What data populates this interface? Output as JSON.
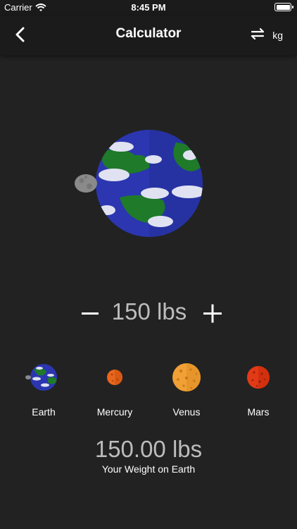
{
  "status_bar": {
    "carrier": "Carrier",
    "time": "8:45 PM"
  },
  "nav": {
    "title": "Calculator",
    "unit_label": "kg",
    "back_icon": "chevron-left-icon",
    "swap_icon": "swap-arrows-icon"
  },
  "weight": {
    "value": "150 lbs",
    "minus_icon": "minus-icon",
    "plus_icon": "plus-icon"
  },
  "planets": [
    {
      "name": "Earth",
      "color": "#2b36b0"
    },
    {
      "name": "Mercury",
      "color": "#e8661c"
    },
    {
      "name": "Venus",
      "color": "#f0a035"
    },
    {
      "name": "Mars",
      "color": "#e23a16"
    }
  ],
  "result": {
    "value": "150.00 lbs",
    "caption": "Your Weight on Earth"
  },
  "colors": {
    "background": "#222222",
    "bar": "#1b1b1b",
    "earth_ocean": "#2b36b0",
    "earth_land": "#1f7a2a",
    "moon": "#8a8a8a"
  }
}
